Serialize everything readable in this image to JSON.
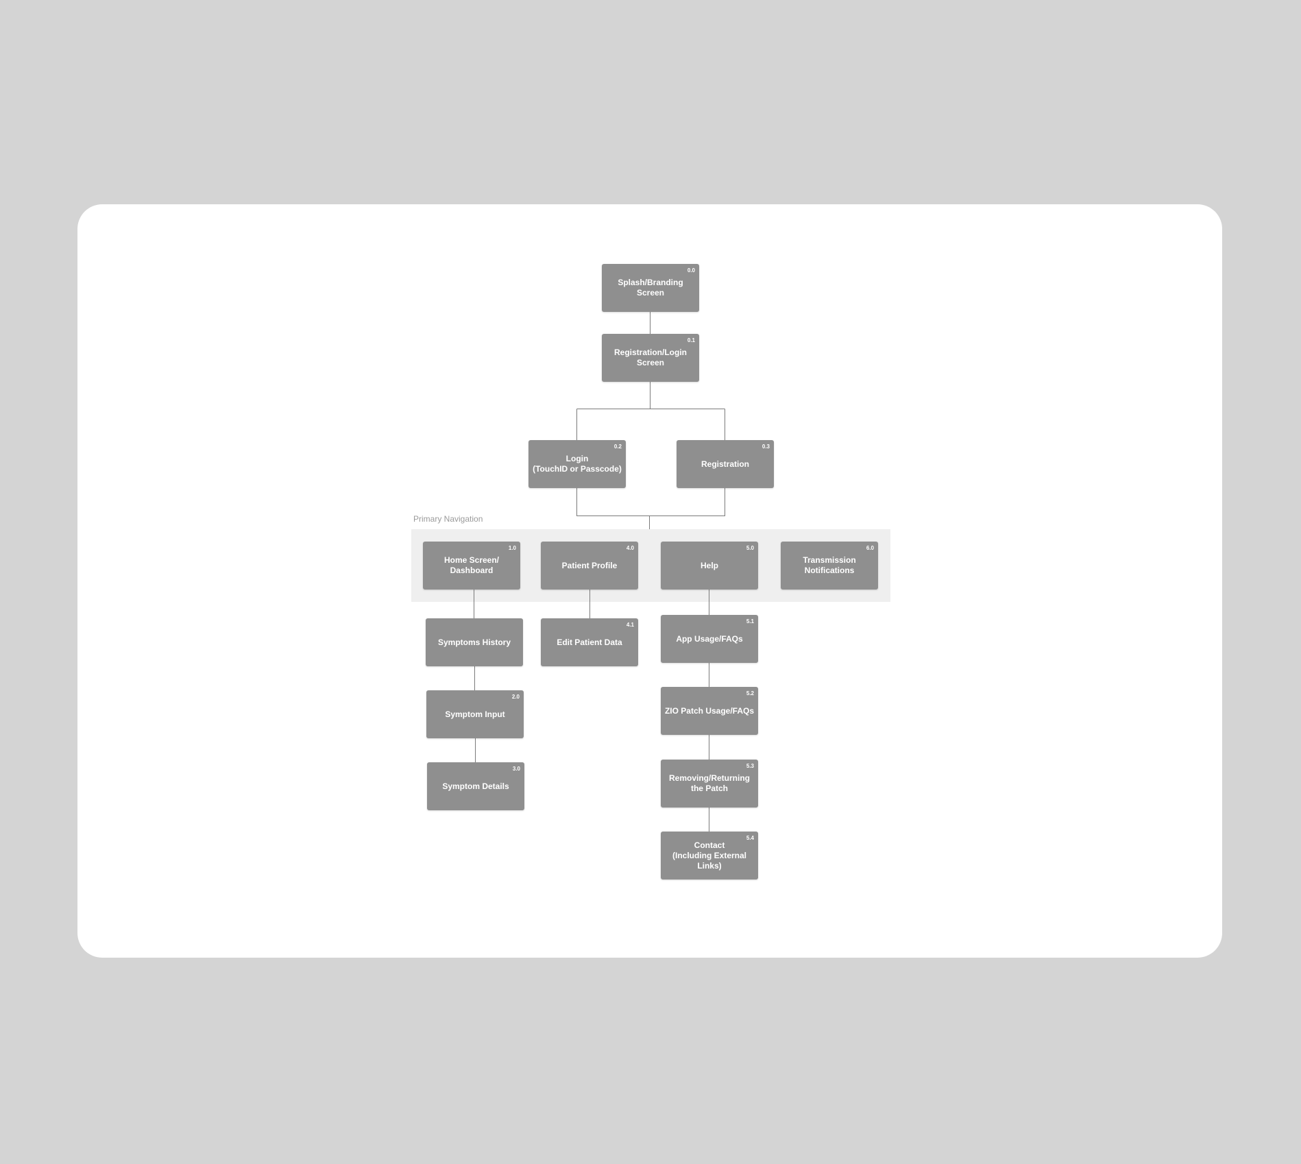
{
  "section_label": "Primary Navigation",
  "colors": {
    "background": "#d4d4d4",
    "card": "#ffffff",
    "node": "#8f8f8f",
    "band": "#efefef",
    "line": "#7a7a7a"
  },
  "nodes": {
    "splash": {
      "num": "0.0",
      "label": "Splash/Branding\nScreen"
    },
    "reg_login": {
      "num": "0.1",
      "label": "Registration/Login\nScreen"
    },
    "login": {
      "num": "0.2",
      "label": "Login\n(TouchID or Passcode)"
    },
    "registration": {
      "num": "0.3",
      "label": "Registration"
    },
    "home": {
      "num": "1.0",
      "label": "Home Screen/\nDashboard"
    },
    "patient_profile": {
      "num": "4.0",
      "label": "Patient Profile"
    },
    "help": {
      "num": "5.0",
      "label": "Help"
    },
    "transmission": {
      "num": "6.0",
      "label": "Transmission\nNotifications"
    },
    "symptoms_history": {
      "num": "",
      "label": "Symptoms History"
    },
    "symptom_input": {
      "num": "2.0",
      "label": "Symptom Input"
    },
    "symptom_details": {
      "num": "3.0",
      "label": "Symptom Details"
    },
    "edit_patient": {
      "num": "4.1",
      "label": "Edit Patient Data"
    },
    "app_usage": {
      "num": "5.1",
      "label": "App Usage/FAQs"
    },
    "zio_patch": {
      "num": "5.2",
      "label": "ZIO Patch Usage/FAQs"
    },
    "removing": {
      "num": "5.3",
      "label": "Removing/Returning\nthe Patch"
    },
    "contact": {
      "num": "5.4",
      "label": "Contact\n(Including External\nLinks)"
    }
  }
}
